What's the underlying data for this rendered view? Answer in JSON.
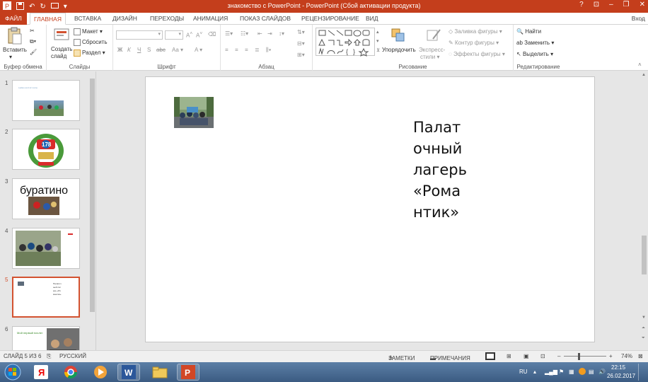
{
  "window": {
    "title": "знакомство с PowerPoint -  PowerPoint (Сбой активации продукта)",
    "help": "?",
    "signin": "Вход"
  },
  "tabs": [
    "ФАЙЛ",
    "ГЛАВНАЯ",
    "ВСТАВКА",
    "ДИЗАЙН",
    "ПЕРЕХОДЫ",
    "АНИМАЦИЯ",
    "ПОКАЗ СЛАЙДОВ",
    "РЕЦЕНЗИРОВАНИЕ",
    "ВИД"
  ],
  "ribbon": {
    "clipboard": {
      "label": "Буфер обмена",
      "paste": "Вставить"
    },
    "slides": {
      "label": "Слайды",
      "new_slide_1": "Создать",
      "new_slide_2": "слайд",
      "layout": "Макет",
      "reset": "Сбросить",
      "section": "Раздел"
    },
    "font": {
      "label": "Шрифт",
      "bold": "Ж",
      "italic": "К",
      "underline": "Ч",
      "strike": "S",
      "spacing": "abc",
      "case": "Aa",
      "color": "A",
      "grow": "A",
      "shrink": "A"
    },
    "paragraph": {
      "label": "Абзац"
    },
    "drawing": {
      "label": "Рисование",
      "arrange": "Упорядочить",
      "quick_styles_1": "Экспресс-",
      "quick_styles_2": "стили",
      "fill": "Заливка фигуры",
      "outline": "Контур фигуры",
      "effects": "Эффекты фигуры"
    },
    "editing": {
      "label": "Редактирование",
      "find": "Найти",
      "replace": "Заменить",
      "select": "Выделить"
    }
  },
  "thumbnails": [
    {
      "num": "1",
      "text": "Ladies and sir name"
    },
    {
      "num": "2",
      "text": "178"
    },
    {
      "num": "3",
      "text": "буратино"
    },
    {
      "num": "4",
      "text": ""
    },
    {
      "num": "5",
      "text": "Палаточный лагерь «Романтик»"
    },
    {
      "num": "6",
      "text": "Мой первый ночлег"
    }
  ],
  "slide": {
    "text": "Палаточный лагерь «Романтик»"
  },
  "status": {
    "slide_counter": "СЛАЙД 5 ИЗ 6",
    "language": "РУССКИЙ",
    "notes": "ЗАМЕТКИ",
    "comments": "ПРИМЕЧАНИЯ",
    "zoom": "74%"
  },
  "tray": {
    "lang": "RU",
    "time": "22:15",
    "date": "26.02.2017"
  },
  "colors": {
    "accent": "#c43e1c",
    "selected_thumb": "#d35230",
    "taskbar": "#3b5b82"
  }
}
